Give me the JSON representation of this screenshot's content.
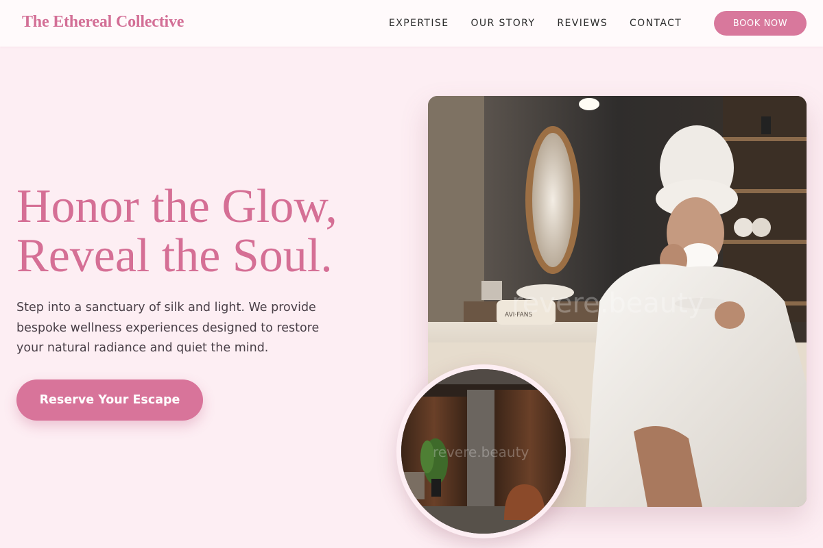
{
  "header": {
    "brand": "The Ethereal Collective",
    "nav": [
      "EXPERTISE",
      "OUR STORY",
      "REVIEWS",
      "CONTACT"
    ],
    "book_label": "BOOK NOW"
  },
  "hero": {
    "headline_line1": "Honor the Glow,",
    "headline_line2": "Reveal the Soul.",
    "lede": "Step into a sanctuary of silk and light. We provide bespoke wellness experiences designed to restore your natural radiance and quiet the mind.",
    "cta_label": "Reserve Your Escape"
  },
  "images": {
    "main_watermark": "revere.beauty",
    "circle_watermark": "revere.beauty",
    "pillow_text": "AVI·FANS"
  },
  "colors": {
    "accent": "#d8789c",
    "headline": "#d56f95",
    "background": "#fdeef3"
  }
}
